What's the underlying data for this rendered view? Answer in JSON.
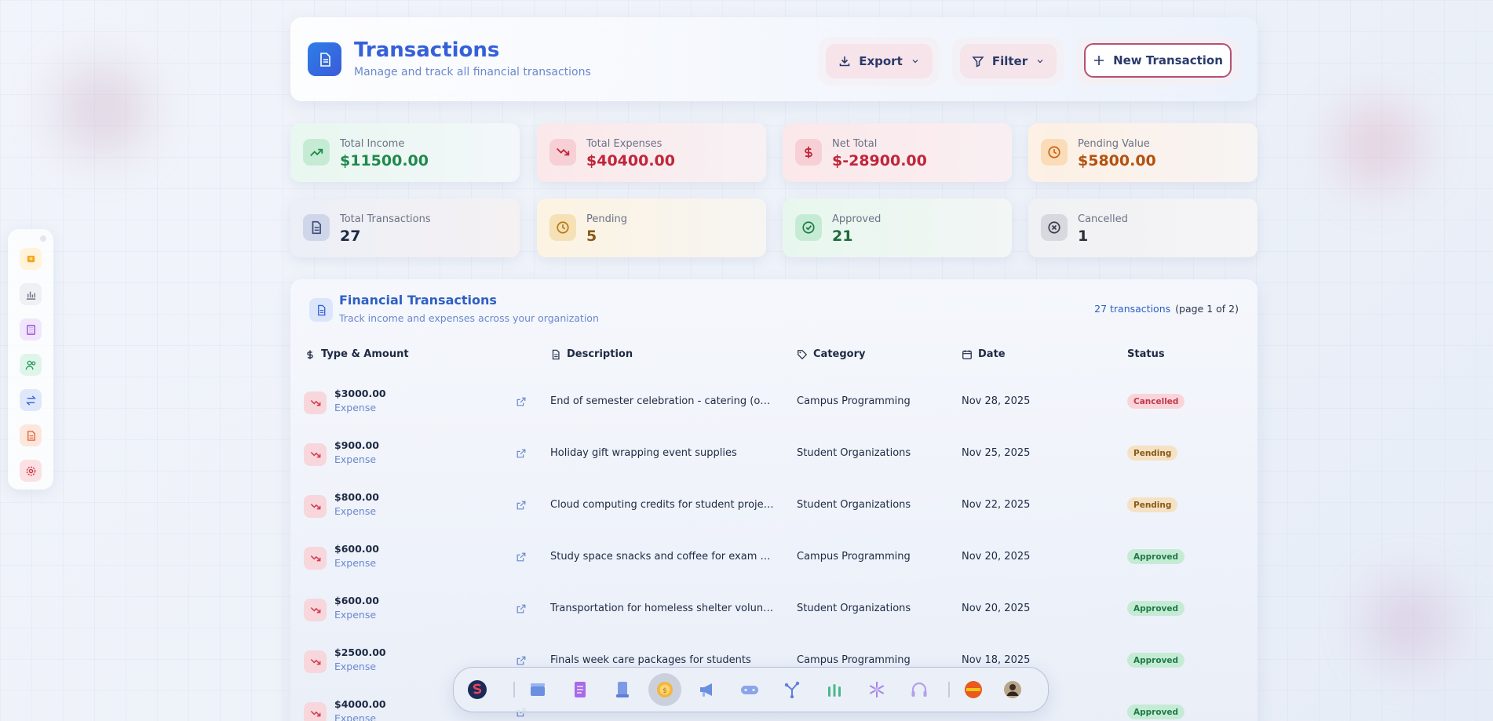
{
  "header": {
    "title": "Transactions",
    "subtitle": "Manage and track all financial transactions",
    "export_label": "Export",
    "filter_label": "Filter",
    "new_label": "New Transaction"
  },
  "stats": [
    {
      "label": "Total Income",
      "value": "$11500.00",
      "icon": "trending-up-icon",
      "color": "#1f8a4c"
    },
    {
      "label": "Total Expenses",
      "value": "$40400.00",
      "icon": "trending-down-icon",
      "color": "#c0263a"
    },
    {
      "label": "Net Total",
      "value": "$-28900.00",
      "icon": "dollar-icon",
      "color": "#c0263a"
    },
    {
      "label": "Pending Value",
      "value": "$5800.00",
      "icon": "clock-icon",
      "color": "#b3520f"
    },
    {
      "label": "Total Transactions",
      "value": "27",
      "icon": "document-icon",
      "color": "#1e2a44"
    },
    {
      "label": "Pending",
      "value": "5",
      "icon": "clock-icon",
      "color": "#8a5a16"
    },
    {
      "label": "Approved",
      "value": "21",
      "icon": "check-circle-icon",
      "color": "#1f6a3f"
    },
    {
      "label": "Cancelled",
      "value": "1",
      "icon": "x-circle-icon",
      "color": "#2b2f3a"
    }
  ],
  "table": {
    "title": "Financial Transactions",
    "subtitle": "Track income and expenses across your organization",
    "count": "27 transactions",
    "page": "(page 1 of 2)",
    "columns": [
      "Type & Amount",
      "Description",
      "Category",
      "Date",
      "Status"
    ],
    "rows": [
      {
        "amount": "$3000.00",
        "type": "Expense",
        "description": "End of semester celebration - catering (over budget)",
        "category": "Campus Programming",
        "date": "Nov 28, 2025",
        "status": "Cancelled"
      },
      {
        "amount": "$900.00",
        "type": "Expense",
        "description": "Holiday gift wrapping event supplies",
        "category": "Student Organizations",
        "date": "Nov 25, 2025",
        "status": "Pending"
      },
      {
        "amount": "$800.00",
        "type": "Expense",
        "description": "Cloud computing credits for student projects",
        "category": "Student Organizations",
        "date": "Nov 22, 2025",
        "status": "Pending"
      },
      {
        "amount": "$600.00",
        "type": "Expense",
        "description": "Study space snacks and coffee for exam period",
        "category": "Campus Programming",
        "date": "Nov 20, 2025",
        "status": "Approved"
      },
      {
        "amount": "$600.00",
        "type": "Expense",
        "description": "Transportation for homeless shelter volunteer visit",
        "category": "Student Organizations",
        "date": "Nov 20, 2025",
        "status": "Approved"
      },
      {
        "amount": "$2500.00",
        "type": "Expense",
        "description": "Finals week care packages for students",
        "category": "Campus Programming",
        "date": "Nov 18, 2025",
        "status": "Approved"
      },
      {
        "amount": "$4000.00",
        "type": "Expense",
        "description": "",
        "category": "",
        "date": "",
        "status": "Approved"
      }
    ]
  },
  "colors": {
    "accent": "#3560d8",
    "expense": "#d23a50",
    "income": "#1f8a4c"
  }
}
